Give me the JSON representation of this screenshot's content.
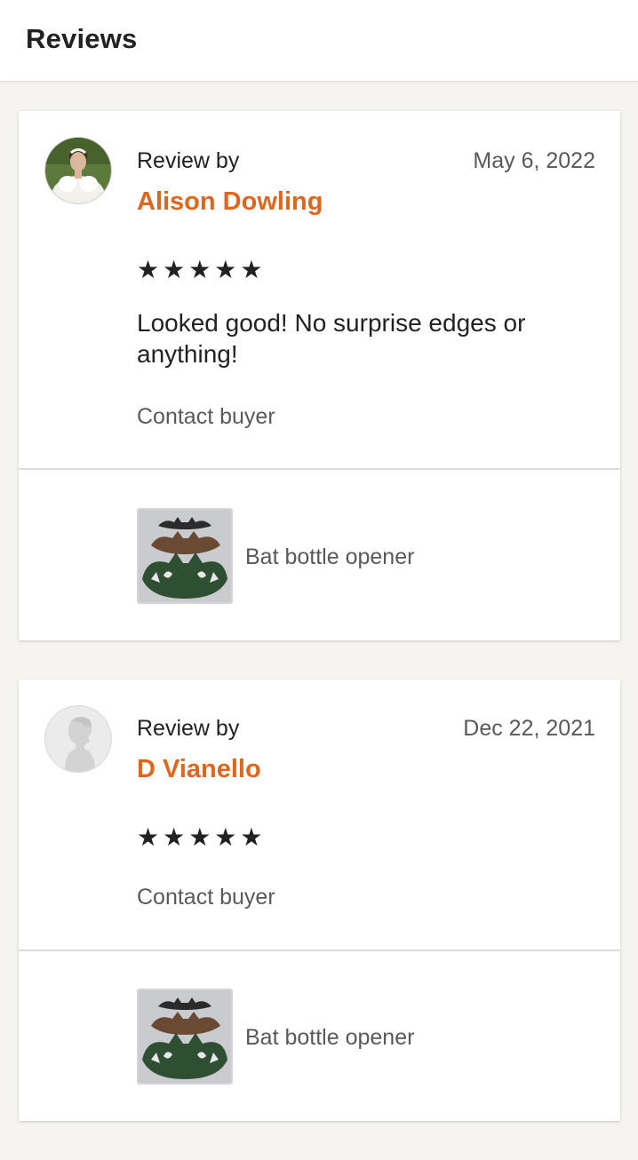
{
  "header": {
    "title": "Reviews"
  },
  "reviews": [
    {
      "review_by_label": "Review by",
      "reviewer": "Alison Dowling",
      "date": "May 6, 2022",
      "stars": "★★★★★",
      "rating": 5,
      "text": "Looked good! No surprise edges or anything!",
      "contact_label": "Contact buyer",
      "item_title": "Bat bottle opener",
      "avatar_icon": "user-photo-avatar"
    },
    {
      "review_by_label": "Review by",
      "reviewer": "D Vianello",
      "date": "Dec 22, 2021",
      "stars": "★★★★★",
      "rating": 5,
      "text": "",
      "contact_label": "Contact buyer",
      "item_title": "Bat bottle opener",
      "avatar_icon": "default-avatar-silhouette-icon"
    }
  ],
  "colors": {
    "reviewer_name": "#e0661c",
    "page_background": "#f5f4f1",
    "card_background": "#ffffff"
  }
}
